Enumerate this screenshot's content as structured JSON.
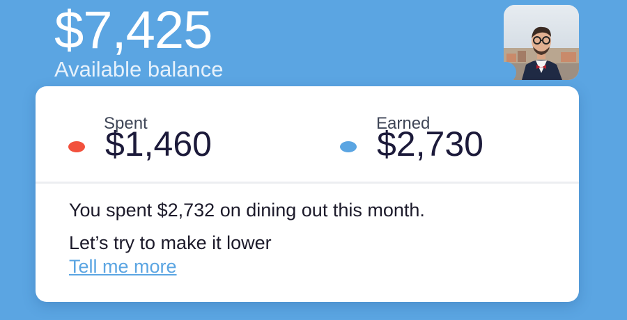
{
  "balance": {
    "amount": "$7,425",
    "label": "Available balance"
  },
  "avatar": {
    "icon": "user-photo"
  },
  "stats": {
    "spent": {
      "label": "Spent",
      "value": "$1,460",
      "color": "#f2513d"
    },
    "earned": {
      "label": "Earned",
      "value": "$2,730",
      "color": "#5ba5e2"
    }
  },
  "insight": {
    "line1": "You spent $2,732 on dining out this month.",
    "line2": "Let’s try to make it lower",
    "link": "Tell me more"
  },
  "colors": {
    "background": "#5ba5e2",
    "card": "#ffffff",
    "accent": "#5ba5e2",
    "spent": "#f2513d"
  }
}
